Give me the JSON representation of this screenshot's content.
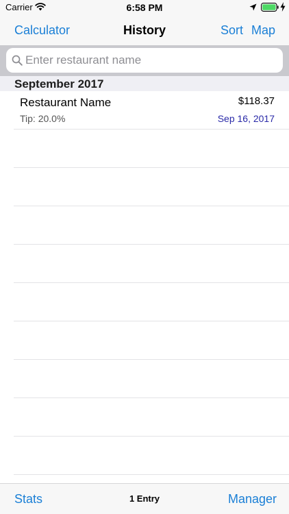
{
  "status_bar": {
    "carrier": "Carrier",
    "time": "6:58 PM"
  },
  "nav": {
    "left_label": "Calculator",
    "title": "History",
    "sort_label": "Sort",
    "map_label": "Map"
  },
  "search": {
    "placeholder": "Enter restaurant name",
    "value": ""
  },
  "sections": [
    {
      "title": "September 2017",
      "entries": [
        {
          "name": "Restaurant Name",
          "amount": "$118.37",
          "tip": "Tip: 20.0%",
          "date": "Sep 16, 2017"
        }
      ]
    }
  ],
  "toolbar": {
    "stats_label": "Stats",
    "count_label": "1 Entry",
    "manager_label": "Manager"
  },
  "colors": {
    "accent": "#1a7fd6",
    "date": "#2a2aa8",
    "bar_background": "#f7f7f7",
    "section_background": "#efeff4"
  }
}
